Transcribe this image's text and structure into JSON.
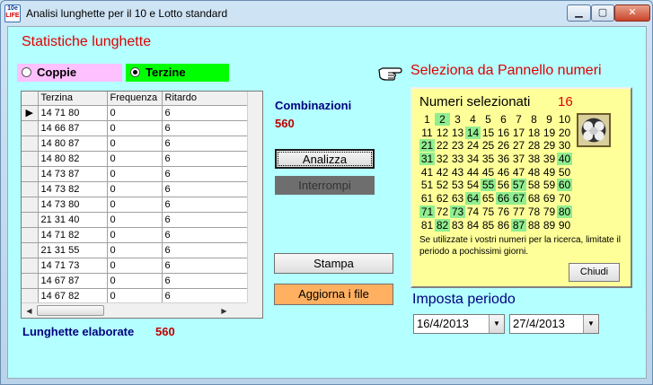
{
  "window": {
    "title": "Analisi lunghette per il 10 e Lotto standard",
    "icon_line1": "10e",
    "icon_line2": "LIFE",
    "min_label": "▁",
    "max_label": "▢",
    "close_label": "✕"
  },
  "headers": {
    "statistiche": "Statistiche lunghette",
    "seleziona": "Seleziona da Pannello numeri",
    "periodo": "Imposta periodo"
  },
  "radios": {
    "coppie": "Coppie",
    "terzine": "Terzine",
    "selected": "terzine"
  },
  "grid": {
    "columns": [
      "Terzina",
      "Frequenza",
      "Ritardo"
    ],
    "rows": [
      [
        "14  71  80",
        "0",
        "6"
      ],
      [
        "14  66  87",
        "0",
        "6"
      ],
      [
        "14  80  87",
        "0",
        "6"
      ],
      [
        "14  80  82",
        "0",
        "6"
      ],
      [
        "14  73  87",
        "0",
        "6"
      ],
      [
        "14  73  82",
        "0",
        "6"
      ],
      [
        "14  73  80",
        "0",
        "6"
      ],
      [
        "21  31  40",
        "0",
        "6"
      ],
      [
        "14  71  82",
        "0",
        "6"
      ],
      [
        "21  31  55",
        "0",
        "6"
      ],
      [
        "14  71  73",
        "0",
        "6"
      ],
      [
        "14  67  87",
        "0",
        "6"
      ],
      [
        "14  67  82",
        "0",
        "6"
      ],
      [
        "14  67  80",
        "0",
        "6"
      ]
    ],
    "current_row": 0
  },
  "combinazioni": {
    "label": "Combinazioni",
    "value": "560"
  },
  "lunghette": {
    "label": "Lunghette elaborate",
    "value": "560"
  },
  "buttons": {
    "analizza": "Analizza",
    "interrompi": "Interrompi",
    "stampa": "Stampa",
    "aggiorna": "Aggiorna i file",
    "chiudi": "Chiudi"
  },
  "panel": {
    "title": "Numeri selezionati",
    "count": "16",
    "numbers": [
      "1",
      "2",
      "3",
      "4",
      "5",
      "6",
      "7",
      "8",
      "9",
      "10",
      "11",
      "12",
      "13",
      "14",
      "15",
      "16",
      "17",
      "18",
      "19",
      "20",
      "21",
      "22",
      "23",
      "24",
      "25",
      "26",
      "27",
      "28",
      "29",
      "30",
      "31",
      "32",
      "33",
      "34",
      "35",
      "36",
      "37",
      "38",
      "39",
      "40",
      "41",
      "42",
      "43",
      "44",
      "45",
      "46",
      "47",
      "48",
      "49",
      "50",
      "51",
      "52",
      "53",
      "54",
      "55",
      "56",
      "57",
      "58",
      "59",
      "60",
      "61",
      "62",
      "63",
      "64",
      "65",
      "66",
      "67",
      "68",
      "69",
      "70",
      "71",
      "72",
      "73",
      "74",
      "75",
      "76",
      "77",
      "78",
      "79",
      "80",
      "81",
      "82",
      "83",
      "84",
      "85",
      "86",
      "87",
      "88",
      "89",
      "90"
    ],
    "selected": [
      2,
      14,
      21,
      31,
      40,
      55,
      57,
      60,
      64,
      66,
      67,
      71,
      73,
      80,
      82,
      87
    ],
    "note": "Se utilizzate i vostri numeri per la ricerca, limitate il periodo a pochissimi giorni."
  },
  "periodo": {
    "da": "16/4/2013",
    "a": "27/4/2013"
  },
  "colors": {
    "client_bg": "#b4ffff",
    "header_red": "#e00000",
    "label_blue": "#000080",
    "coppie_bg": "#ffc0ff",
    "terzine_bg": "#00ff00",
    "panel_bg": "#ffff99",
    "highlight": "#90ee90",
    "aggiorna_bg": "#ffb061"
  }
}
